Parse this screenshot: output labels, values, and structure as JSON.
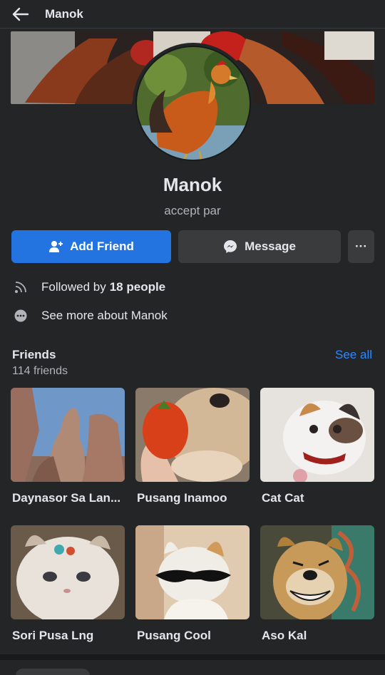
{
  "header": {
    "title": "Manok",
    "back_icon": "arrow-left-icon"
  },
  "profile": {
    "name": "Manok",
    "subtitle": "accept par",
    "cover_icon": "rooster-cover-photo",
    "avatar_icon": "rooster-avatar"
  },
  "actions": {
    "add_friend_label": "Add Friend",
    "add_friend_icon": "add-person-icon",
    "message_label": "Message",
    "message_icon": "messenger-icon",
    "more_label": "···",
    "accent_color": "#2374e1"
  },
  "info": {
    "followed_prefix": "Followed by",
    "followed_count": "18 people",
    "followed_icon": "rss-feed-icon",
    "more_about": "See more about Manok",
    "more_icon": "ellipsis-circle-icon"
  },
  "friends": {
    "title": "Friends",
    "count": "114 friends",
    "see_all": "See all",
    "link_color": "#2d88ff",
    "items": [
      {
        "name": "Daynasor Sa Lan...",
        "photo": "rock-formation-photo"
      },
      {
        "name": "Pusang Inamoo",
        "photo": "cat-eating-strawberry-photo"
      },
      {
        "name": "Cat Cat",
        "photo": "cat-with-bow-photo"
      },
      {
        "name": "Sori Pusa Lng",
        "photo": "fluffy-kitten-photo"
      },
      {
        "name": "Pusang Cool",
        "photo": "cat-sunglasses-photo"
      },
      {
        "name": "Aso Kal",
        "photo": "smiling-dog-photo"
      }
    ]
  }
}
